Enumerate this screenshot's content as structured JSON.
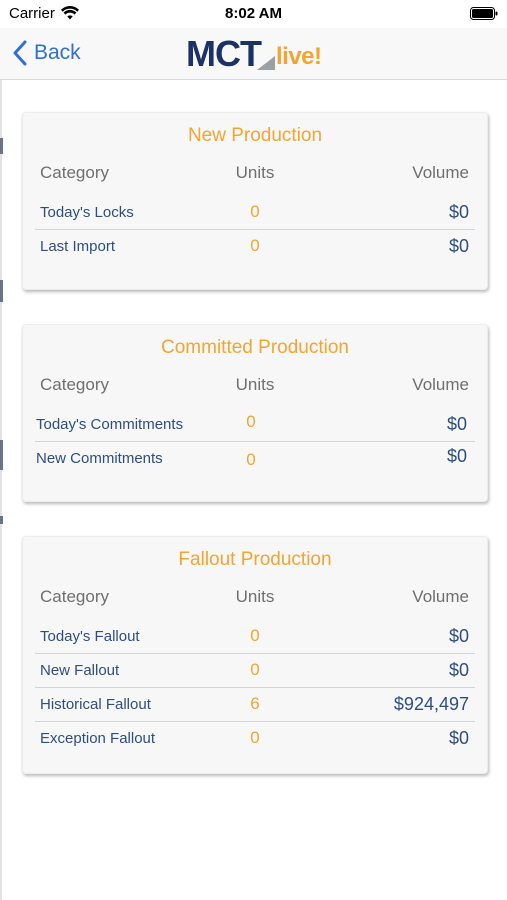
{
  "status_bar": {
    "carrier": "Carrier",
    "time": "8:02 AM",
    "wifi_icon": "wifi-icon",
    "battery_icon": "battery-icon"
  },
  "nav": {
    "back_label": "Back",
    "back_icon": "chevron-left-icon",
    "logo_primary": "MCT",
    "logo_secondary": "live!"
  },
  "colors": {
    "accent_orange": "#f2a530",
    "text_navy": "#2e4f7d",
    "link_blue": "#2f6fd6",
    "logo_navy": "#1c3166"
  },
  "sections": [
    {
      "title": "New Production",
      "headers": {
        "category": "Category",
        "units": "Units",
        "volume": "Volume"
      },
      "rows": [
        {
          "category": "Today's Locks",
          "units": "0",
          "volume": "$0"
        },
        {
          "category": "Last Import",
          "units": "0",
          "volume": "$0"
        }
      ]
    },
    {
      "title": "Committed Production",
      "headers": {
        "category": "Category",
        "units": "Units",
        "volume": "Volume"
      },
      "rows": [
        {
          "category": "Today's Commitments",
          "units": "0",
          "volume": "$0"
        },
        {
          "category": "New Commitments",
          "units": "0",
          "volume": "$0"
        }
      ]
    },
    {
      "title": "Fallout Production",
      "headers": {
        "category": "Category",
        "units": "Units",
        "volume": "Volume"
      },
      "rows": [
        {
          "category": "Today's Fallout",
          "units": "0",
          "volume": "$0"
        },
        {
          "category": "New Fallout",
          "units": "0",
          "volume": "$0"
        },
        {
          "category": "Historical Fallout",
          "units": "6",
          "volume": "$924,497"
        },
        {
          "category": "Exception Fallout",
          "units": "0",
          "volume": "$0"
        }
      ]
    }
  ]
}
